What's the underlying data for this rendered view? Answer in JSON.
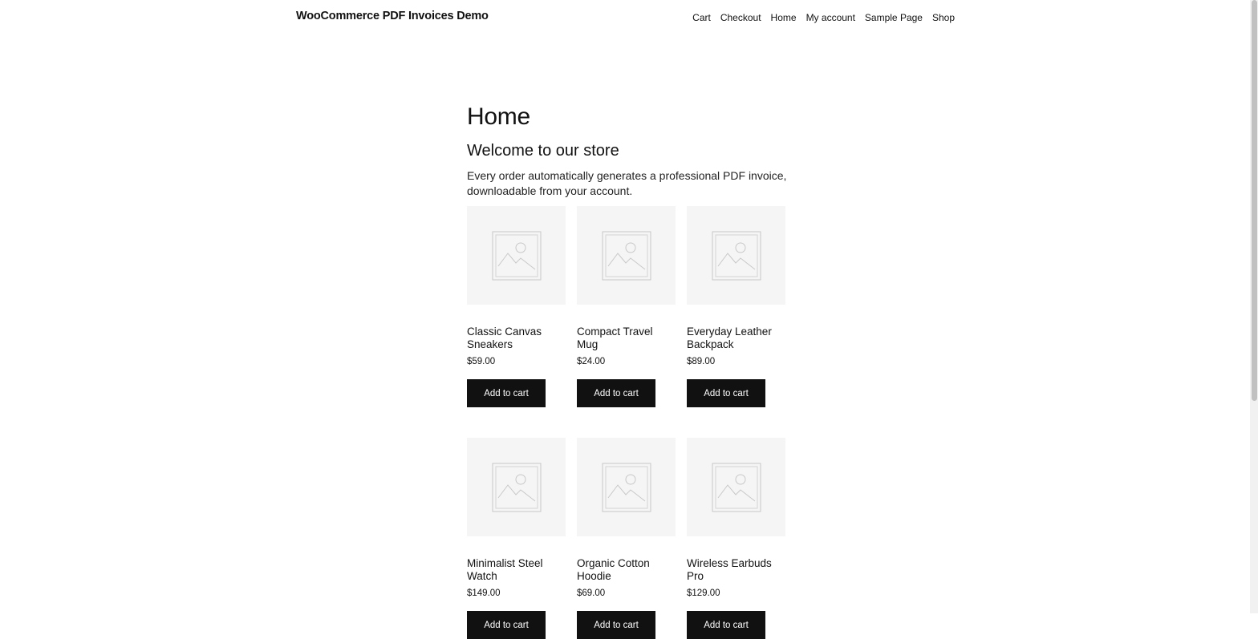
{
  "header": {
    "site_title": "WooCommerce PDF Invoices Demo",
    "nav": [
      "Cart",
      "Checkout",
      "Home",
      "My account",
      "Sample Page",
      "Shop"
    ]
  },
  "main": {
    "page_title": "Home",
    "welcome_heading": "Welcome to our store",
    "intro_text": "Every order automatically generates a professional PDF invoice, downloadable from your account."
  },
  "products": [
    {
      "name": "Classic Canvas Sneakers",
      "price": "$59.00",
      "button": "Add to cart"
    },
    {
      "name": "Compact Travel Mug",
      "price": "$24.00",
      "button": "Add to cart"
    },
    {
      "name": "Everyday Leather Backpack",
      "price": "$89.00",
      "button": "Add to cart"
    },
    {
      "name": "Minimalist Steel Watch",
      "price": "$149.00",
      "button": "Add to cart"
    },
    {
      "name": "Organic Cotton Hoodie",
      "price": "$69.00",
      "button": "Add to cart"
    },
    {
      "name": "Wireless Earbuds Pro",
      "price": "$129.00",
      "button": "Add to cart"
    }
  ],
  "icons": {
    "product_placeholder": "image-placeholder-icon"
  },
  "colors": {
    "button_bg": "#111111",
    "thumb_bg": "#f5f5f5",
    "text": "#111111"
  }
}
